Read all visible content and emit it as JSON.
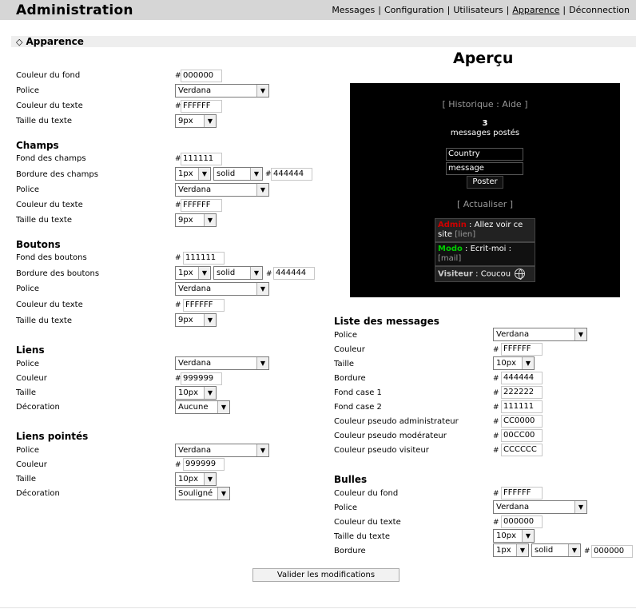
{
  "header": {
    "title": "Administration",
    "nav": [
      "Messages",
      "Configuration",
      "Utilisateurs",
      "Apparence",
      "Déconnection"
    ],
    "active_index": 3,
    "separator": "|"
  },
  "section": {
    "title": "Apparence"
  },
  "hash": "#",
  "general": {
    "bg_label": "Couleur du fond",
    "bg_value": "000000",
    "font_label": "Police",
    "font_value": "Verdana",
    "color_label": "Couleur du texte",
    "color_value": "FFFFFF",
    "size_label": "Taille du texte",
    "size_value": "9px"
  },
  "champs": {
    "heading": "Champs",
    "bg_label": "Fond des champs",
    "bg_value": "111111",
    "border_label": "Bordure des champs",
    "border_width": "1px",
    "border_style": "solid",
    "border_color": "444444",
    "font_label": "Police",
    "font_value": "Verdana",
    "color_label": "Couleur du texte",
    "color_value": "FFFFFF",
    "size_label": "Taille du texte",
    "size_value": "9px"
  },
  "boutons": {
    "heading": "Boutons",
    "bg_label": "Fond des boutons",
    "bg_value": "111111",
    "border_label": "Bordure des boutons",
    "border_width": "1px",
    "border_style": "solid",
    "border_color": "444444",
    "font_label": "Police",
    "font_value": "Verdana",
    "color_label": "Couleur du texte",
    "color_value": "FFFFFF",
    "size_label": "Taille du texte",
    "size_value": "9px"
  },
  "liens": {
    "heading": "Liens",
    "font_label": "Police",
    "font_value": "Verdana",
    "color_label": "Couleur",
    "color_value": "999999",
    "size_label": "Taille",
    "size_value": "10px",
    "deco_label": "Décoration",
    "deco_value": "Aucune"
  },
  "liens_pointes": {
    "heading": "Liens pointés",
    "font_label": "Police",
    "font_value": "Verdana",
    "color_label": "Couleur",
    "color_value": "999999",
    "size_label": "Taille",
    "size_value": "10px",
    "deco_label": "Décoration",
    "deco_value": "Souligné"
  },
  "preview": {
    "title": "Aperçu",
    "history": "[ Historique : Aide ]",
    "count": "3",
    "posted": "messages postés",
    "name_value": "Country",
    "message_value": "message",
    "post_button": "Poster",
    "refresh": "[ Actualiser ]",
    "messages": [
      {
        "nick": "Admin",
        "text": " : Allez voir ce site ",
        "link": "[lien]",
        "color": "#CC0000"
      },
      {
        "nick": "Modo",
        "text": " : Ecrit-moi : ",
        "link": "[mail]",
        "color": "#00CC00"
      },
      {
        "nick": "Visiteur",
        "text": " : Coucou ",
        "link": "",
        "color": "#CCCCCC"
      }
    ]
  },
  "liste": {
    "heading": "Liste des messages",
    "font_label": "Police",
    "font_value": "Verdana",
    "color_label": "Couleur",
    "color_value": "FFFFFF",
    "size_label": "Taille",
    "size_value": "10px",
    "border_label": "Bordure",
    "border_value": "444444",
    "cell1_label": "Fond case 1",
    "cell1_value": "222222",
    "cell2_label": "Fond case 2",
    "cell2_value": "111111",
    "admin_label": "Couleur pseudo administrateur",
    "admin_value": "CC0000",
    "modo_label": "Couleur pseudo modérateur",
    "modo_value": "00CC00",
    "visitor_label": "Couleur pseudo visiteur",
    "visitor_value": "CCCCCC"
  },
  "bulles": {
    "heading": "Bulles",
    "bg_label": "Couleur du fond",
    "bg_value": "FFFFFF",
    "font_label": "Police",
    "font_value": "Verdana",
    "color_label": "Couleur du texte",
    "color_value": "000000",
    "size_label": "Taille du texte",
    "size_value": "10px",
    "border_label": "Bordure",
    "border_width": "1px",
    "border_style": "solid",
    "border_color": "000000"
  },
  "submit_label": "Valider les modifications"
}
